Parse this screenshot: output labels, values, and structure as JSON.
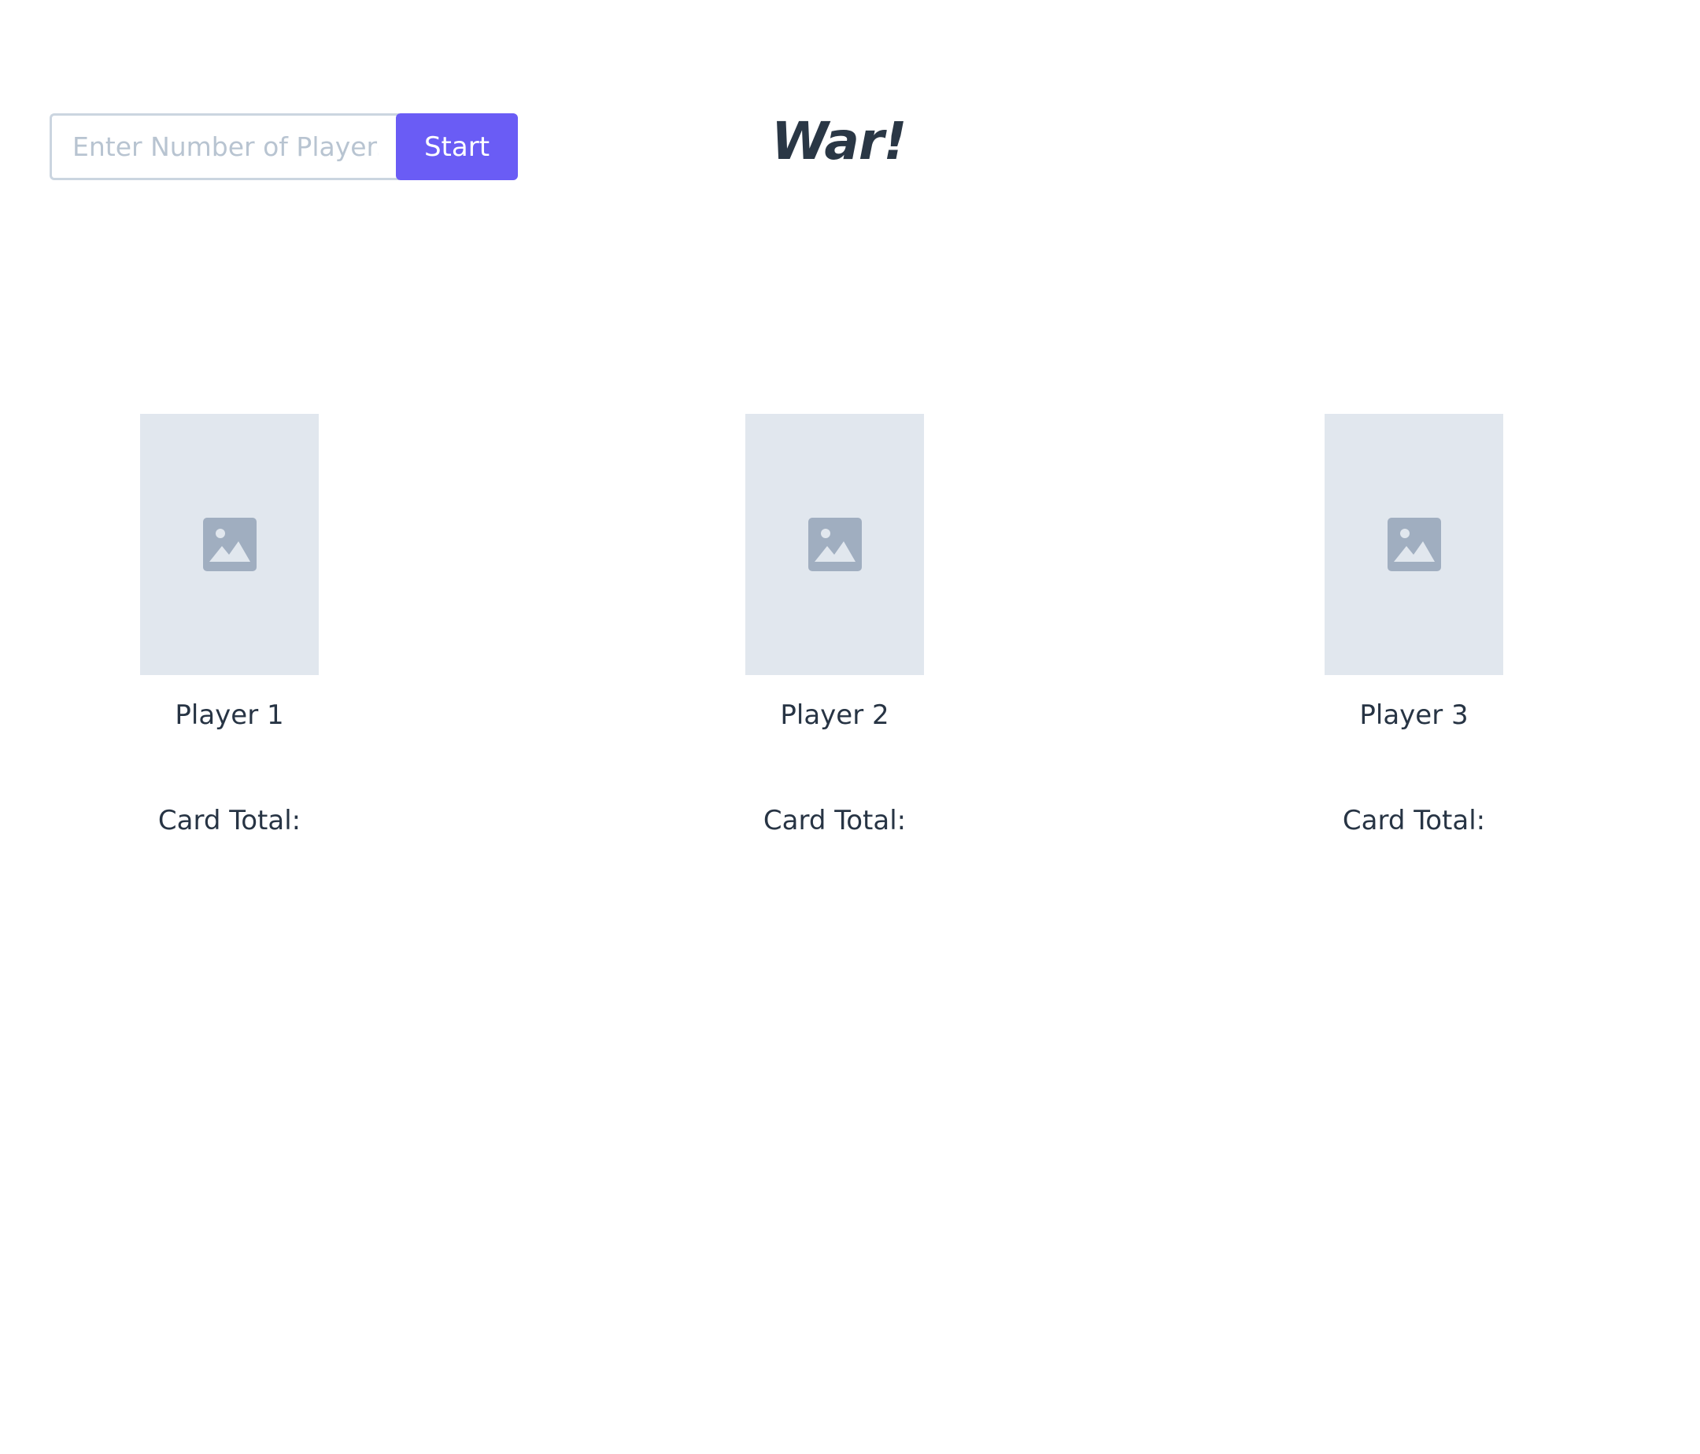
{
  "controls": {
    "input_placeholder": "Enter Number of Players",
    "input_value": "",
    "start_label": "Start"
  },
  "title": "War!",
  "players": [
    {
      "name": "Player 1",
      "card_total_label": "Card Total:",
      "card_icon": "image-placeholder-icon"
    },
    {
      "name": "Player 2",
      "card_total_label": "Card Total:",
      "card_icon": "image-placeholder-icon"
    },
    {
      "name": "Player 3",
      "card_total_label": "Card Total:",
      "card_icon": "image-placeholder-icon"
    }
  ],
  "colors": {
    "accent": "#6a5cf5",
    "card_placeholder": "#e1e7ee",
    "icon": "#a0aec0",
    "text": "#273444"
  }
}
